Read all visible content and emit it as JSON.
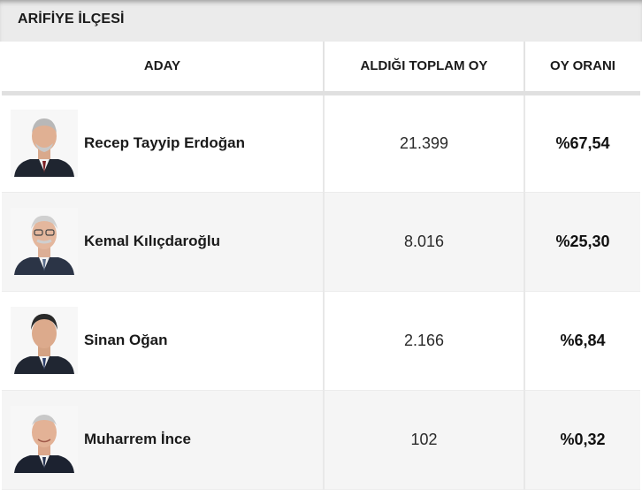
{
  "district_title": "ARİFİYE İLÇESİ",
  "columns": {
    "candidate": "ADAY",
    "total_votes": "ALDIĞI TOPLAM OY",
    "vote_rate": "OY ORANI"
  },
  "rows": [
    {
      "name": "Recep Tayyip Erdoğan",
      "votes": "21.399",
      "rate": "%67,54",
      "photo_icon": "candidate-photo-icon"
    },
    {
      "name": "Kemal Kılıçdaroğlu",
      "votes": "8.016",
      "rate": "%25,30",
      "photo_icon": "candidate-photo-icon"
    },
    {
      "name": "Sinan Oğan",
      "votes": "2.166",
      "rate": "%6,84",
      "photo_icon": "candidate-photo-icon"
    },
    {
      "name": "Muharrem İnce",
      "votes": "102",
      "rate": "%0,32",
      "photo_icon": "candidate-photo-icon"
    }
  ]
}
